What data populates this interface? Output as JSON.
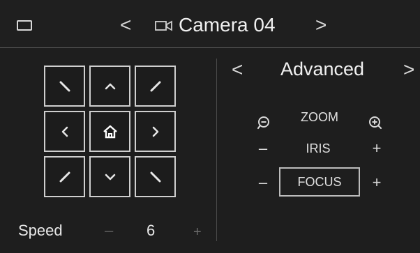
{
  "header": {
    "title": "Camera 04",
    "prev_glyph": "<",
    "next_glyph": ">",
    "camera_icon": "video-camera-icon",
    "menu_icon": "window-icon"
  },
  "ptz": {
    "buttons": [
      {
        "name": "pan-up-left",
        "icon": "arrow-up-left-icon"
      },
      {
        "name": "pan-up",
        "icon": "chevron-up-icon"
      },
      {
        "name": "pan-up-right",
        "icon": "arrow-up-right-icon"
      },
      {
        "name": "pan-left",
        "icon": "chevron-left-icon"
      },
      {
        "name": "home",
        "icon": "home-icon"
      },
      {
        "name": "pan-right",
        "icon": "chevron-right-icon"
      },
      {
        "name": "pan-down-left",
        "icon": "arrow-down-left-icon"
      },
      {
        "name": "pan-down",
        "icon": "chevron-down-icon"
      },
      {
        "name": "pan-down-right",
        "icon": "arrow-down-right-icon"
      }
    ]
  },
  "advanced": {
    "title": "Advanced",
    "prev_glyph": "<",
    "next_glyph": ">",
    "zoom": {
      "label": "ZOOM",
      "out_icon": "zoom-out-icon",
      "in_icon": "zoom-in-icon"
    },
    "iris": {
      "label": "IRIS",
      "minus": "–",
      "plus": "+"
    },
    "focus": {
      "label": "FOCUS",
      "minus": "–",
      "plus": "+"
    }
  },
  "speed": {
    "label": "Speed",
    "minus": "–",
    "value": "6",
    "plus": "+"
  },
  "colors": {
    "background": "#1e1e1e",
    "border": "#cfcfcf",
    "text": "#e8e8e8"
  }
}
